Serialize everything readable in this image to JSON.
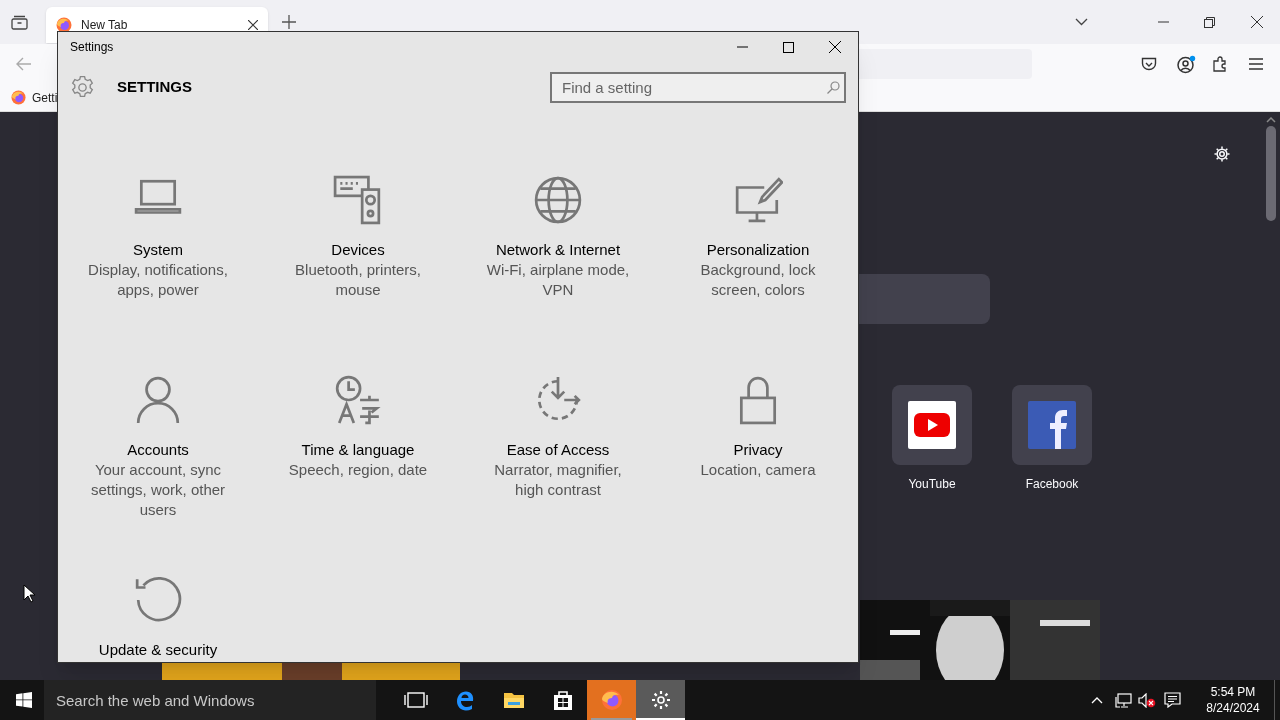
{
  "browser": {
    "tabs": [
      {
        "title": "New Tab",
        "selected": true
      }
    ],
    "bookmarks": [
      {
        "label": "Getti"
      }
    ],
    "shortcuts": [
      {
        "label": "YouTube",
        "kind": "youtube"
      },
      {
        "label": "Facebook",
        "kind": "facebook"
      }
    ]
  },
  "settings_window": {
    "title": "Settings",
    "header": "SETTINGS",
    "search": {
      "placeholder": "Find a setting"
    },
    "categories": [
      {
        "kind": "system",
        "title": "System",
        "description": "Display, notifications, apps, power"
      },
      {
        "kind": "devices",
        "title": "Devices",
        "description": "Bluetooth, printers, mouse"
      },
      {
        "kind": "network",
        "title": "Network & Internet",
        "description": "Wi-Fi, airplane mode, VPN"
      },
      {
        "kind": "personalization",
        "title": "Personalization",
        "description": "Background, lock screen, colors"
      },
      {
        "kind": "accounts",
        "title": "Accounts",
        "description": "Your account, sync settings, work, other users"
      },
      {
        "kind": "time",
        "title": "Time & language",
        "description": "Speech, region, date"
      },
      {
        "kind": "ease",
        "title": "Ease of Access",
        "description": "Narrator, magnifier, high contrast"
      },
      {
        "kind": "privacy",
        "title": "Privacy",
        "description": "Location, camera"
      },
      {
        "kind": "update",
        "title": "Update & security"
      }
    ]
  },
  "taskbar": {
    "search": {
      "placeholder": "Search the web and Windows"
    },
    "apps": [
      {
        "kind": "task-view",
        "open": false,
        "selected": false,
        "flashing": false
      },
      {
        "kind": "edge",
        "open": false,
        "selected": false,
        "flashing": false
      },
      {
        "kind": "explorer",
        "open": false,
        "selected": false,
        "flashing": false
      },
      {
        "kind": "store",
        "open": false,
        "selected": false,
        "flashing": false
      },
      {
        "kind": "firefox",
        "open": true,
        "selected": false,
        "flashing": true
      },
      {
        "kind": "settings",
        "open": true,
        "selected": true,
        "flashing": false
      }
    ],
    "clock": {
      "time": "5:54 PM",
      "date": "8/24/2024"
    }
  }
}
